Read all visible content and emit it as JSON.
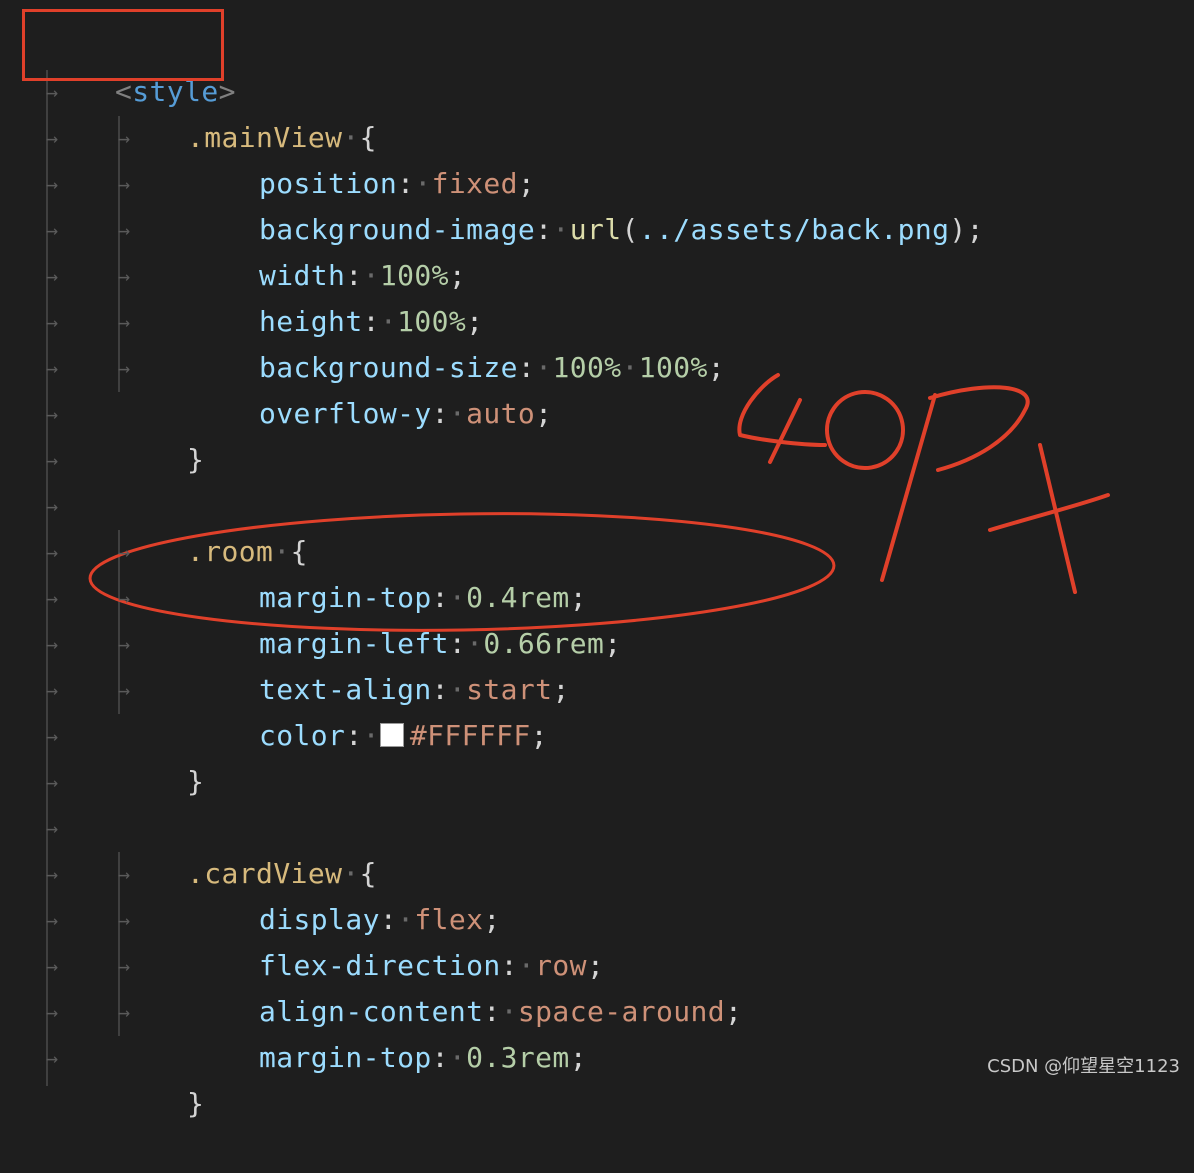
{
  "code": {
    "open_tag": {
      "bracket_open": "<",
      "name": "style",
      "bracket_close": ">"
    },
    "mainview": {
      "selector": ".mainView",
      "brace_open": "{",
      "decls": [
        {
          "prop": "position",
          "value": "fixed"
        },
        {
          "prop": "background-image",
          "fn": "url",
          "arg": "../assets/back.png"
        },
        {
          "prop": "width",
          "value": "100%"
        },
        {
          "prop": "height",
          "value": "100%"
        },
        {
          "prop": "background-size",
          "value": "100%",
          "value2": "100%"
        },
        {
          "prop": "overflow-y",
          "value": "auto"
        }
      ],
      "brace_close": "}"
    },
    "room": {
      "selector": ".room",
      "brace_open": "{",
      "decls": [
        {
          "prop": "margin-top",
          "value": "0.4rem"
        },
        {
          "prop": "margin-left",
          "value": "0.66rem"
        },
        {
          "prop": "text-align",
          "value": "start"
        },
        {
          "prop": "color",
          "value": "#FFFFFF",
          "swatch": "#ffffff"
        }
      ],
      "brace_close": "}"
    },
    "cardview": {
      "selector": ".cardView",
      "brace_open": "{",
      "decls": [
        {
          "prop": "display",
          "value": "flex"
        },
        {
          "prop": "flex-direction",
          "value": "row"
        },
        {
          "prop": "align-content",
          "value": "space-around"
        },
        {
          "prop": "margin-top",
          "value": "0.3rem"
        }
      ],
      "brace_close": "}"
    },
    "punct": {
      "colon": ":",
      "semicolon": ";",
      "space_dot": "·",
      "paren_open": "(",
      "paren_close": ")"
    }
  },
  "annotations": {
    "handwriting": "40px",
    "color": "#e0402a"
  },
  "watermark": "CSDN @仰望星空1123",
  "colors": {
    "background": "#1e1e1e",
    "tag": "#569cd6",
    "selector": "#d7ba7d",
    "property": "#9cdcfe",
    "keyword_value": "#ce9178",
    "number_value": "#b5cea8",
    "function": "#dcdcaa"
  }
}
